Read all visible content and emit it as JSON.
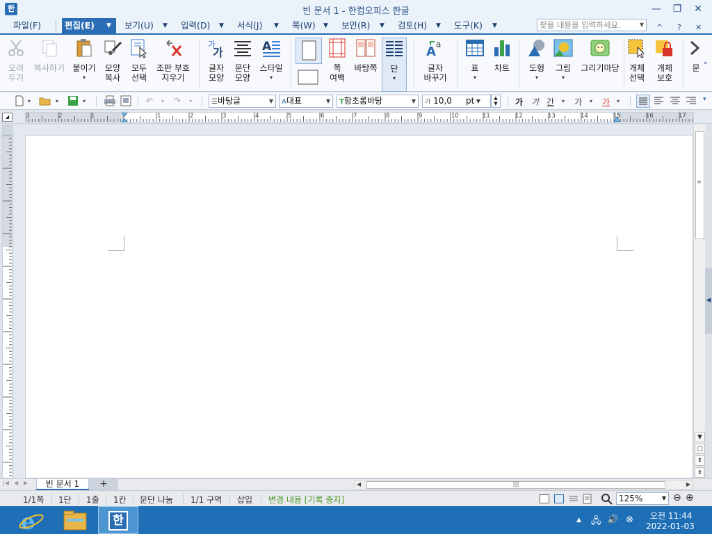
{
  "window": {
    "title": "빈 문서 1 - 한컴오피스 한글",
    "logo_text": "한",
    "minimize": "—",
    "maximize": "❐",
    "close": "✕"
  },
  "menubar": {
    "items": [
      {
        "label": "파일(F)",
        "active": false
      },
      {
        "label": "편집(E)",
        "active": true
      },
      {
        "label": "보기(U)",
        "active": false
      },
      {
        "label": "입력(D)",
        "active": false
      },
      {
        "label": "서식(J)",
        "active": false
      },
      {
        "label": "쪽(W)",
        "active": false
      },
      {
        "label": "보안(R)",
        "active": false
      },
      {
        "label": "검토(H)",
        "active": false
      },
      {
        "label": "도구(K)",
        "active": false
      }
    ],
    "search_placeholder": "찾을 내용을 입력하세요.",
    "collapse_icon": "^",
    "help_icon": "?",
    "close_doc_icon": "✕"
  },
  "ribbon": {
    "buttons": [
      {
        "label": "오려\n두기",
        "icon": "scissors-icon",
        "disabled": true
      },
      {
        "label": "복사하기",
        "icon": "copy-icon",
        "disabled": true
      },
      {
        "label": "붙이기",
        "icon": "paste-icon",
        "disabled": false
      },
      {
        "label": "모양\n복사",
        "icon": "format-painter-icon",
        "disabled": false
      },
      {
        "label": "모두\n선택",
        "icon": "select-all-icon",
        "disabled": false
      },
      {
        "label": "조판 부호\n지우기",
        "icon": "clear-marks-icon",
        "disabled": false
      },
      {
        "label": "글자\n모양",
        "icon": "char-shape-icon",
        "disabled": false
      },
      {
        "label": "문단\n모양",
        "icon": "para-shape-icon",
        "disabled": false
      },
      {
        "label": "스타일",
        "icon": "style-icon",
        "disabled": false
      },
      {
        "label": "쪽\n여백",
        "icon": "page-margin-icon",
        "disabled": false
      },
      {
        "label": "바탕쪽",
        "icon": "master-page-icon",
        "disabled": false
      },
      {
        "label": "단",
        "icon": "columns-icon",
        "disabled": false
      },
      {
        "label": "글자\n바꾸기",
        "icon": "replace-char-icon",
        "disabled": false
      },
      {
        "label": "표",
        "icon": "table-icon",
        "disabled": false
      },
      {
        "label": "차트",
        "icon": "chart-icon",
        "disabled": false
      },
      {
        "label": "도형",
        "icon": "shape-icon",
        "disabled": false
      },
      {
        "label": "그림",
        "icon": "picture-icon",
        "disabled": false
      },
      {
        "label": "그리기마당",
        "icon": "clipart-icon",
        "disabled": false
      },
      {
        "label": "개체\n선택",
        "icon": "object-select-icon",
        "disabled": false
      },
      {
        "label": "개체\n보호",
        "icon": "object-protect-icon",
        "disabled": false
      },
      {
        "label": "문",
        "icon": "more-icon",
        "disabled": false
      }
    ]
  },
  "format_toolbar": {
    "style_value": "바탕글",
    "lang_value": "대표",
    "font_value": "함초롬바탕",
    "size_value": "10,0",
    "size_unit": "pt",
    "bold": "가",
    "italic": "가",
    "underline": "간",
    "strike": "가",
    "color": "가"
  },
  "ruler": {
    "numbers": [
      "3",
      "2",
      "1",
      "1",
      "2",
      "3",
      "4",
      "5",
      "6",
      "7",
      "8",
      "9",
      "10",
      "11",
      "12",
      "13",
      "14",
      "15",
      "16",
      "17"
    ]
  },
  "tabs": {
    "doc_tab": "빈 문서 1",
    "add_tab": "+"
  },
  "statusbar": {
    "page": "1/1쪽",
    "column": "1단",
    "line": "1줄",
    "char": "1칸",
    "break": "문단 나눔",
    "section": "1/1 구역",
    "mode": "삽입",
    "track": "변경 내용 [기록 중지]",
    "zoom": "125%",
    "zoom_out": "⊖",
    "zoom_in": "⊕"
  },
  "taskbar": {
    "time": "오전 11:44",
    "date": "2022-01-03",
    "hwp_app_label": "한"
  },
  "colors": {
    "accent": "#2a6db5",
    "taskbar": "#1e6fb6",
    "track_text": "#4c9a2a"
  }
}
